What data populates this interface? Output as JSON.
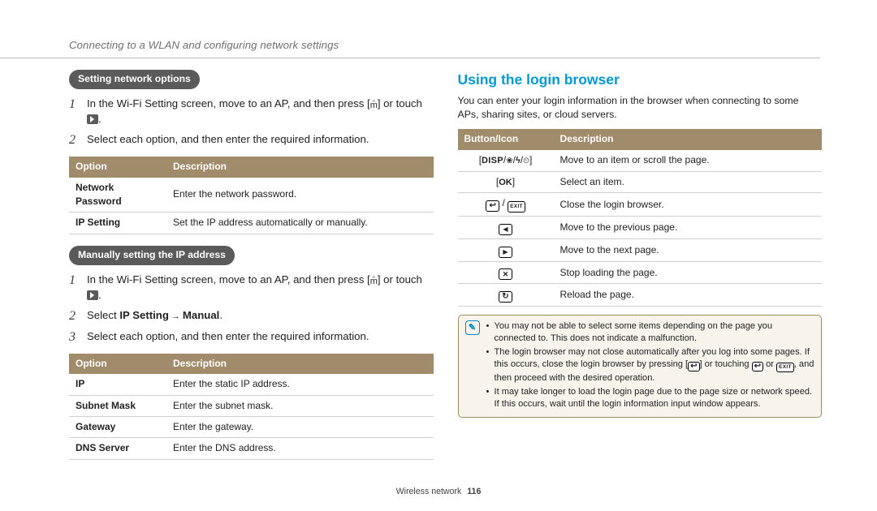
{
  "section_header": "Connecting to a WLAN and configuring network settings",
  "left": {
    "pill1": "Setting network options",
    "steps1": [
      {
        "pre": "In the Wi-Fi Setting screen, move to an AP, and then press [",
        "icon": "m",
        "mid": "] or touch ",
        "touch_icon": "arrow",
        "post": "."
      },
      {
        "pre": "Select each option, and then enter the required information."
      }
    ],
    "table1": {
      "headers": [
        "Option",
        "Description"
      ],
      "rows": [
        [
          "Network Password",
          "Enter the network password."
        ],
        [
          "IP Setting",
          "Set the IP address automatically or manually."
        ]
      ]
    },
    "pill2": "Manually setting the IP address",
    "steps2": [
      {
        "pre": "In the Wi-Fi Setting screen, move to an AP, and then press [",
        "icon": "m",
        "mid": "] or touch ",
        "touch_icon": "arrow",
        "post": "."
      },
      {
        "pre": "Select ",
        "bold1": "IP Setting",
        "arrow": " → ",
        "bold2": "Manual",
        "post": "."
      },
      {
        "pre": "Select each option, and then enter the required information."
      }
    ],
    "table2": {
      "headers": [
        "Option",
        "Description"
      ],
      "rows": [
        [
          "IP",
          "Enter the static IP address."
        ],
        [
          "Subnet Mask",
          "Enter the subnet mask."
        ],
        [
          "Gateway",
          "Enter the gateway."
        ],
        [
          "DNS Server",
          "Enter the DNS address."
        ]
      ]
    }
  },
  "right": {
    "heading": "Using the login browser",
    "intro": "You can enter your login information in the browser when connecting to some APs, sharing sites, or cloud servers.",
    "table": {
      "headers": [
        "Button/Icon",
        "Description"
      ],
      "rows": [
        {
          "icon_key": "disp",
          "desc": "Move to an item or scroll the page."
        },
        {
          "icon_key": "ok",
          "desc": "Select an item."
        },
        {
          "icon_key": "back_exit",
          "desc": "Close the login browser."
        },
        {
          "icon_key": "prev",
          "desc": "Move to the previous page."
        },
        {
          "icon_key": "next",
          "desc": "Move to the next page."
        },
        {
          "icon_key": "stop",
          "desc": "Stop loading the page."
        },
        {
          "icon_key": "reload",
          "desc": "Reload the page."
        }
      ]
    },
    "notes": [
      "You may not be able to select some items depending on the page you connected to. This does not indicate a malfunction.",
      "The login browser may not close automatically after you log into some pages. If this occurs, close the login browser by pressing [↩] or touching ↩ or EXIT, and then proceed with the desired operation.",
      "It may take longer to load the login page due to the page size or network speed. If this occurs, wait until the login information input window appears."
    ]
  },
  "footer": {
    "section": "Wireless network",
    "page": "116"
  }
}
